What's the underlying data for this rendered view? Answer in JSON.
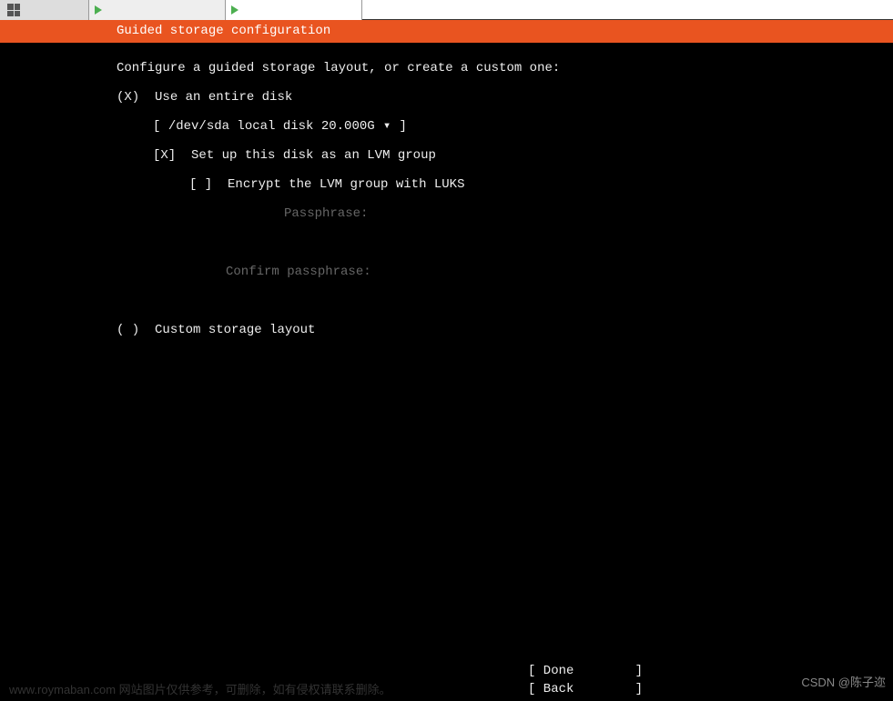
{
  "header": {
    "title": "Guided storage configuration"
  },
  "content": {
    "intro": "Configure a guided storage layout, or create a custom one:",
    "option1": {
      "mark": "(X)",
      "label": "Use an entire disk"
    },
    "disk_select": {
      "open": "[ ",
      "value": "/dev/sda local disk 20.000G",
      "arrow": "▾",
      "close": " ]"
    },
    "lvm": {
      "mark": "[X]",
      "label": "Set up this disk as an LVM group"
    },
    "encrypt": {
      "mark": "[ ]",
      "label": "Encrypt the LVM group with LUKS"
    },
    "passphrase": {
      "label": "Passphrase:"
    },
    "confirm_passphrase": {
      "label": "Confirm passphrase:"
    },
    "option2": {
      "mark": "( )",
      "label": "Custom storage layout"
    }
  },
  "footer": {
    "done": "[ Done        ]",
    "back": "[ Back        ]"
  },
  "watermark": {
    "left": "www.roymaban.com 网站图片仅供参考，可删除，如有侵权请联系删除。",
    "right": "CSDN @陈子迩"
  }
}
